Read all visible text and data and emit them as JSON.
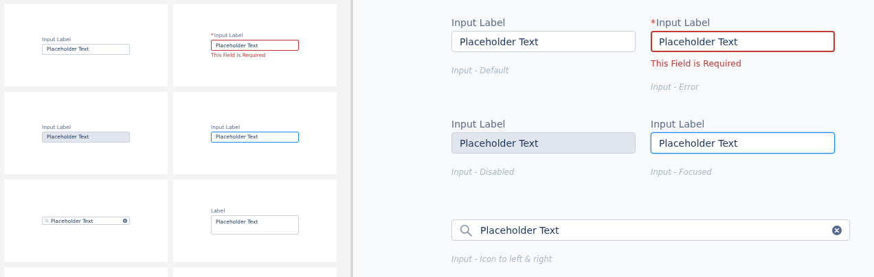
{
  "gallery": {
    "cards": [
      {
        "kind": "default",
        "label": "Input Label",
        "placeholder": "Placeholder Text"
      },
      {
        "kind": "error",
        "required_mark": "*",
        "label": "Input Label",
        "placeholder": "Placeholder Text",
        "error": "This Field is Required"
      },
      {
        "kind": "disabled",
        "label": "Input Label",
        "placeholder": "Placeholder Text"
      },
      {
        "kind": "focused",
        "label": "Input Label",
        "placeholder": "Placeholder Text"
      },
      {
        "kind": "search",
        "placeholder": "Placeholder Text"
      },
      {
        "kind": "textarea",
        "label": "Label",
        "placeholder": "Placeholder Text"
      },
      {
        "kind": "empty"
      },
      {
        "kind": "empty"
      }
    ]
  },
  "preview": {
    "rows": [
      [
        {
          "kind": "default",
          "label": "Input Label",
          "placeholder": "Placeholder Text",
          "caption": "Input - Default"
        },
        {
          "kind": "error",
          "required_mark": "*",
          "label": "Input Label",
          "placeholder": "Placeholder Text",
          "error": "This Field is Required",
          "caption": "Input - Error"
        }
      ],
      [
        {
          "kind": "disabled",
          "label": "Input Label",
          "placeholder": "Placeholder Text",
          "caption": "Input - Disabled"
        },
        {
          "kind": "focused",
          "label": "Input Label",
          "placeholder": "Placeholder Text",
          "caption": "Input - Focused"
        }
      ],
      [
        {
          "kind": "search",
          "placeholder": "Placeholder Text",
          "caption": "Input - Icon to left & right"
        }
      ]
    ]
  }
}
